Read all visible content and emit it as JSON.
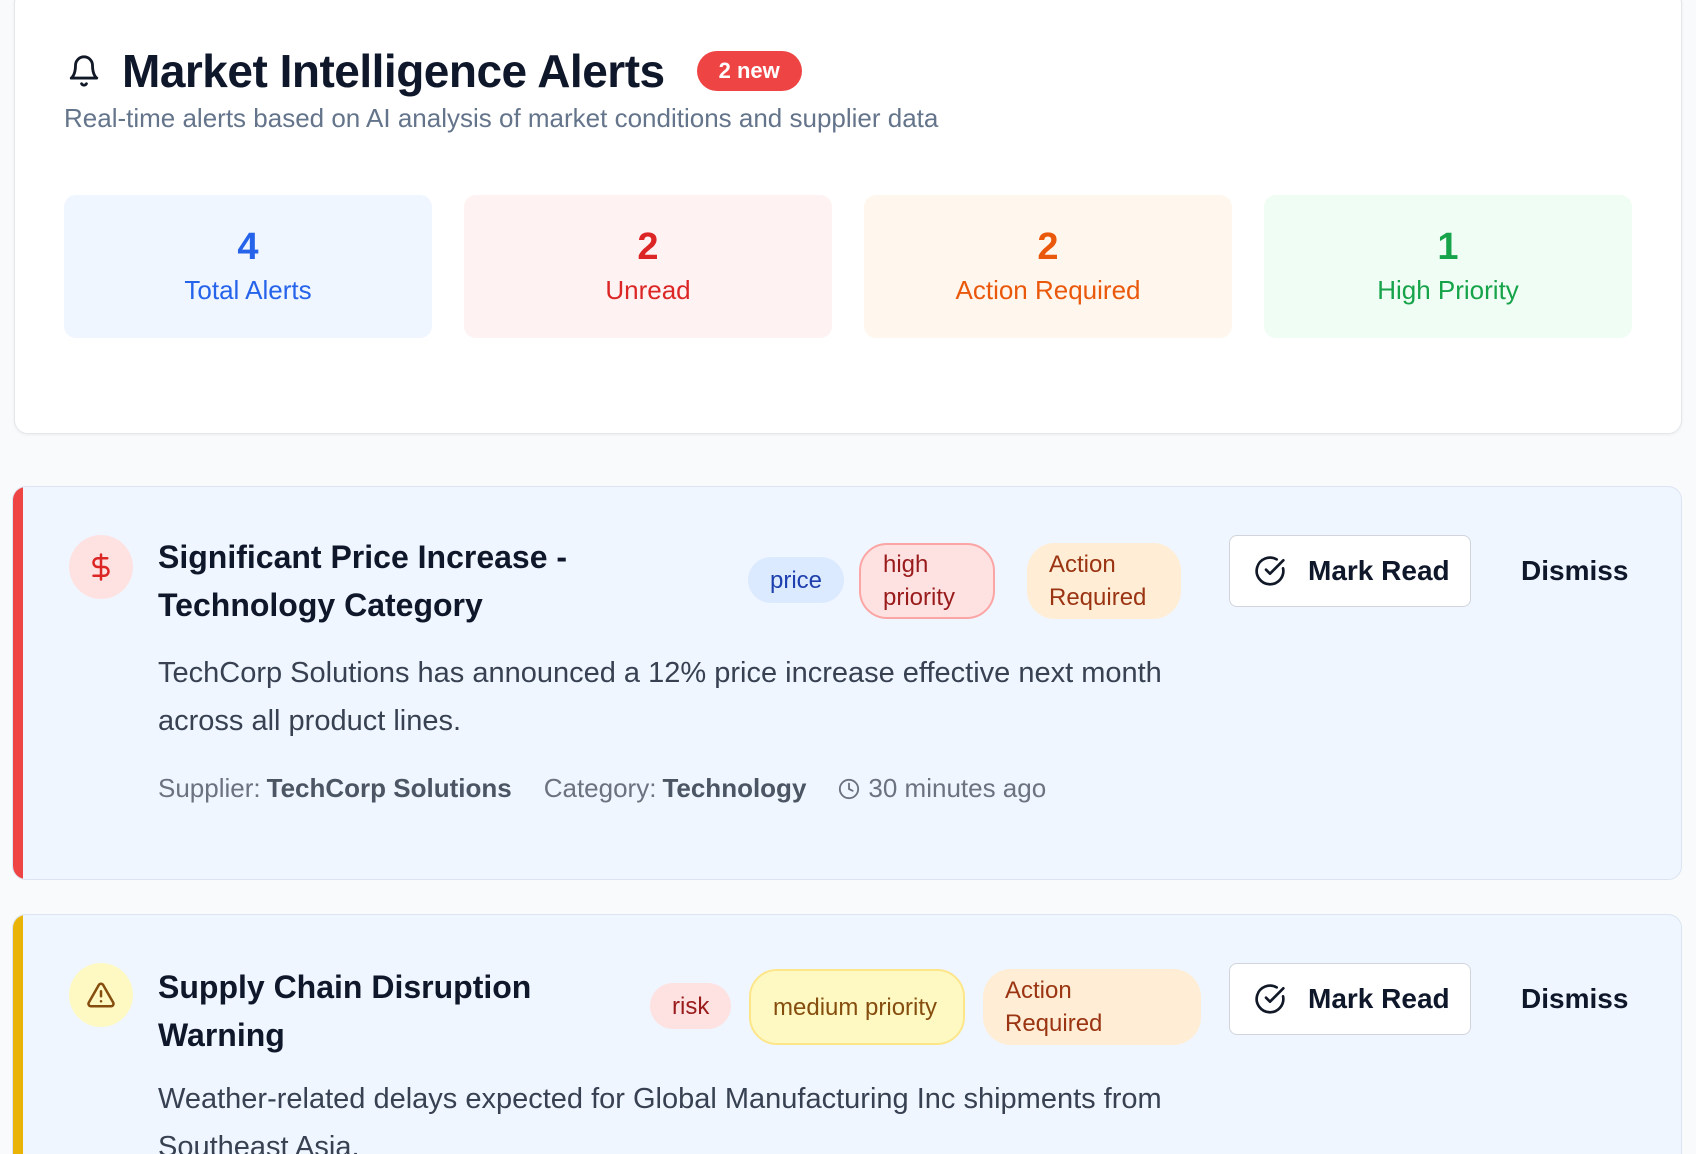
{
  "header": {
    "title": "Market Intelligence Alerts",
    "new_badge": "2 new",
    "subtitle": "Real-time alerts based on AI analysis of market conditions and supplier data",
    "icon": "bell-icon"
  },
  "stats": [
    {
      "value": "4",
      "label": "Total Alerts",
      "color": "#2563eb"
    },
    {
      "value": "2",
      "label": "Unread",
      "color": "#dc2626"
    },
    {
      "value": "2",
      "label": "Action Required",
      "color": "#ea580c"
    },
    {
      "value": "1",
      "label": "High Priority",
      "color": "#16a34a"
    }
  ],
  "alerts": [
    {
      "icon": "dollar-icon",
      "accent": "#ef4444",
      "title": "Significant Price Increase - Technology Category",
      "type_tag": "price",
      "priority_tag": "high priority",
      "action_tag": "Action Required",
      "description": "TechCorp Solutions has announced a 12% price increase effective next month across all product lines.",
      "supplier_label": "Supplier:",
      "supplier": "TechCorp Solutions",
      "category_label": "Category:",
      "category": "Technology",
      "time": "30 minutes ago",
      "mark_read": "Mark Read",
      "dismiss": "Dismiss"
    },
    {
      "icon": "warning-icon",
      "accent": "#eab308",
      "title": "Supply Chain Disruption Warning",
      "type_tag": "risk",
      "priority_tag": "medium priority",
      "action_tag": "Action Required",
      "description": "Weather-related delays expected for Global Manufacturing Inc shipments from Southeast Asia.",
      "mark_read": "Mark Read",
      "dismiss": "Dismiss"
    }
  ]
}
